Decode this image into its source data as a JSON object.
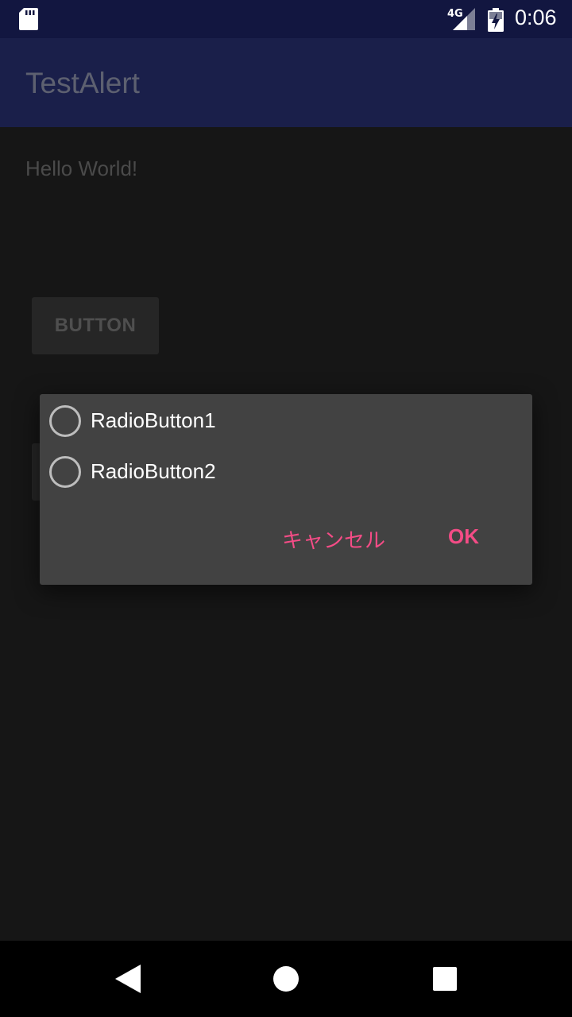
{
  "status_bar": {
    "network": "4G",
    "time": "0:06",
    "icons": [
      "sd-card-icon",
      "signal-icon",
      "battery-charging-icon"
    ]
  },
  "app_bar": {
    "title": "TestAlert"
  },
  "main": {
    "hello_text": "Hello World!",
    "button_label": "BUTTON"
  },
  "dialog": {
    "options": [
      {
        "label": "RadioButton1",
        "selected": false
      },
      {
        "label": "RadioButton2",
        "selected": false
      }
    ],
    "cancel_label": "キャンセル",
    "ok_label": "OK",
    "accent_color": "#f44c86"
  },
  "nav_bar": {
    "icons": [
      "back-icon",
      "home-icon",
      "recents-icon"
    ]
  }
}
